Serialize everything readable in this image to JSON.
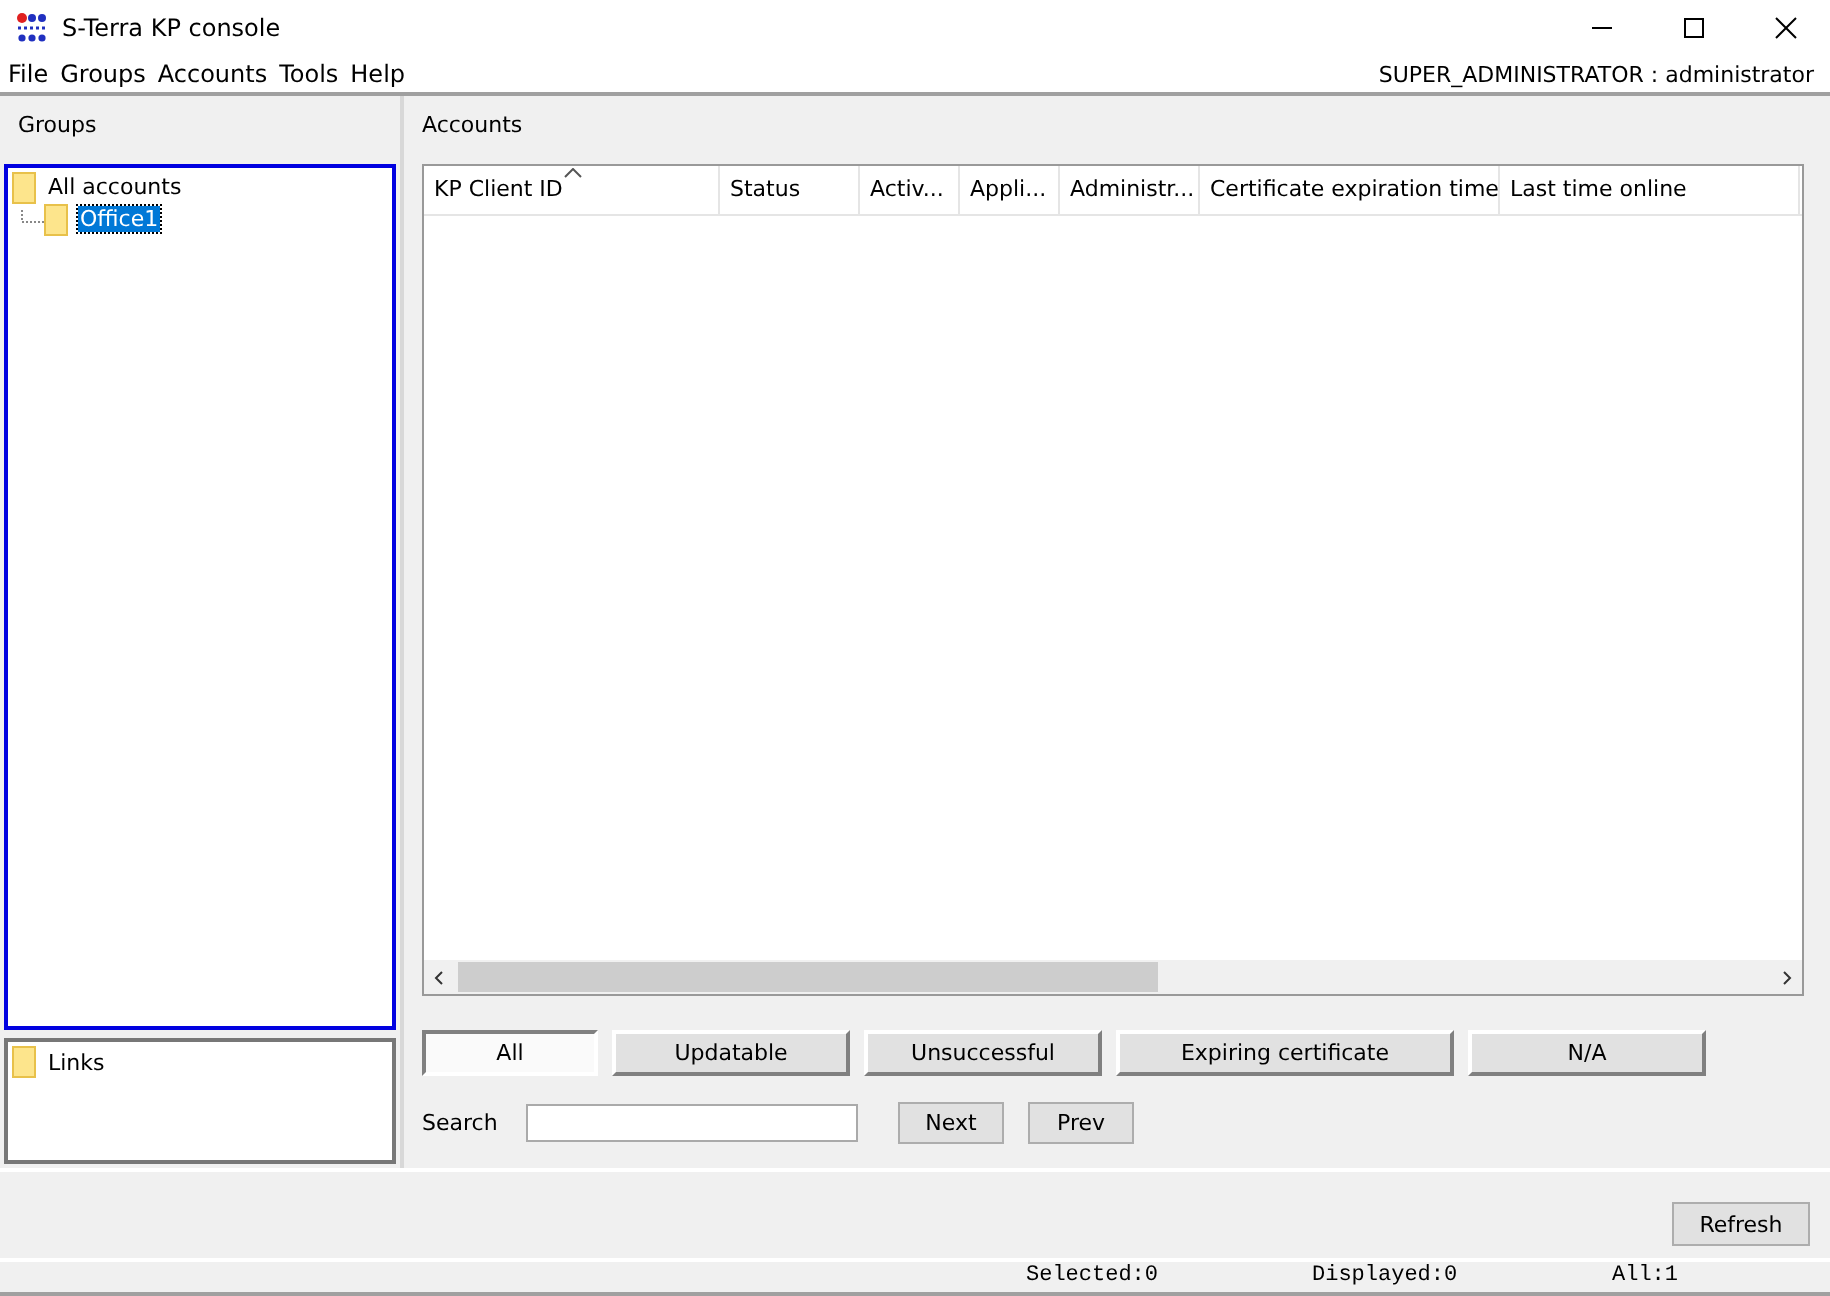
{
  "window": {
    "title": "S-Terra KP console"
  },
  "menu": [
    "File",
    "Groups",
    "Accounts",
    "Tools",
    "Help"
  ],
  "user": "SUPER_ADMINISTRATOR : administrator",
  "groups": {
    "title": "Groups",
    "tree": [
      {
        "label": "All accounts",
        "selected": false,
        "children": [
          {
            "label": "Office1",
            "selected": true
          }
        ]
      }
    ],
    "links": [
      {
        "label": "Links",
        "selected": false
      }
    ]
  },
  "accounts": {
    "title": "Accounts",
    "columns": [
      {
        "label": "KP Client ID",
        "sorted": true
      },
      {
        "label": "Status",
        "sorted": false
      },
      {
        "label": "Activ...",
        "sorted": false
      },
      {
        "label": "Appli...",
        "sorted": false
      },
      {
        "label": "Administr...",
        "sorted": false
      },
      {
        "label": "Certificate expiration time",
        "sorted": false
      },
      {
        "label": "Last time online",
        "sorted": false
      }
    ],
    "filters": [
      {
        "label": "All",
        "selected": true
      },
      {
        "label": "Updatable",
        "selected": false
      },
      {
        "label": "Unsuccessful",
        "selected": false
      },
      {
        "label": "Expiring certificate",
        "selected": false
      },
      {
        "label": "N/A",
        "selected": false
      }
    ],
    "search_label": "Search",
    "buttons": [
      "Next",
      "Prev"
    ]
  },
  "refresh": "Refresh",
  "status_bar": [
    "Selected:0",
    "Displayed:0",
    "All:1"
  ]
}
